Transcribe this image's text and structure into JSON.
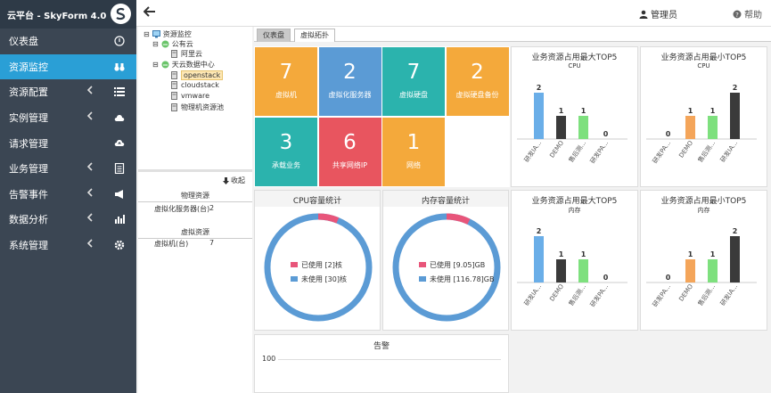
{
  "app": {
    "title": "云平台 - SkyForm 4.0"
  },
  "topbar": {
    "user": "管理员",
    "help": "帮助"
  },
  "sidebar": {
    "items": [
      {
        "label": "仪表盘",
        "icon": "dashboard-icon",
        "has_chevron": false
      },
      {
        "label": "资源监控",
        "icon": "binoculars-icon",
        "has_chevron": false,
        "active": true
      },
      {
        "label": "资源配置",
        "icon": "list-icon",
        "has_chevron": true
      },
      {
        "label": "实例管理",
        "icon": "cloud-icon",
        "has_chevron": true
      },
      {
        "label": "请求管理",
        "icon": "cloud-upload-icon",
        "has_chevron": false
      },
      {
        "label": "业务管理",
        "icon": "document-icon",
        "has_chevron": true
      },
      {
        "label": "告警事件",
        "icon": "megaphone-icon",
        "has_chevron": true
      },
      {
        "label": "数据分析",
        "icon": "bar-chart-icon",
        "has_chevron": true
      },
      {
        "label": "系统管理",
        "icon": "gear-icon",
        "has_chevron": true
      }
    ]
  },
  "tree": {
    "root": "资源监控",
    "public_cloud": "公有云",
    "aliyun": "阿里云",
    "datacenter": "天云数据中心",
    "openstack": "openstack",
    "cloudstack": "cloudstack",
    "vmware": "vmware",
    "physical_pool": "物理机资源池"
  },
  "info": {
    "collapse": "收起",
    "physical_header": "物理资源",
    "virt_server_label": "虚拟化服务器(台)",
    "virt_server_value": "2",
    "virtual_header": "虚拟资源",
    "vm_label": "虚拟机(台)",
    "vm_value": "7"
  },
  "tabs": [
    "仪表盘",
    "虚拟拓扑"
  ],
  "tiles": [
    {
      "value": "7",
      "label": "虚拟机",
      "color": "#f4a93b"
    },
    {
      "value": "2",
      "label": "虚拟化服务器",
      "color": "#5b9bd5"
    },
    {
      "value": "7",
      "label": "虚拟硬盘",
      "color": "#2bb3ad"
    },
    {
      "value": "2",
      "label": "虚拟硬盘备份",
      "color": "#f4a93b"
    },
    {
      "value": "3",
      "label": "承载业务",
      "color": "#2bb3ad"
    },
    {
      "value": "6",
      "label": "共享网络IP",
      "color": "#e8555f"
    },
    {
      "value": "1",
      "label": "网络",
      "color": "#f4a93b"
    }
  ],
  "gauges": [
    {
      "title": "CPU容量统计",
      "used_label": "已使用 [2]核",
      "free_label": "未使用 [30]核",
      "used": 2,
      "total": 32
    },
    {
      "title": "内存容量统计",
      "used_label": "已使用 [9.05]GB",
      "free_label": "未使用 [116.78]GB",
      "used": 9.05,
      "total": 125.83
    }
  ],
  "alarm": {
    "title": "告警",
    "ytick": "100"
  },
  "colors": {
    "used": "#e8557a",
    "free": "#5b9bd5"
  },
  "chart_data": [
    {
      "type": "bar",
      "title": "业务资源占用最大TOP5",
      "subtitle": "CPU",
      "categories": [
        "研发IA...",
        "DEMO",
        "售后测...",
        "研发PA..."
      ],
      "values": [
        2,
        1,
        1,
        0
      ],
      "colors": [
        "#6aaee8",
        "#3a3a3a",
        "#7ee07e",
        "#999999"
      ],
      "ylim": [
        0,
        2
      ]
    },
    {
      "type": "bar",
      "title": "业务资源占用最小TOP5",
      "subtitle": "CPU",
      "categories": [
        "研发PA...",
        "DEMO",
        "售后测...",
        "研发IA..."
      ],
      "values": [
        0,
        1,
        1,
        2
      ],
      "colors": [
        "#999999",
        "#f4a55a",
        "#7ee07e",
        "#3a3a3a"
      ],
      "ylim": [
        0,
        2
      ]
    },
    {
      "type": "bar",
      "title": "业务资源占用最大TOP5",
      "subtitle": "内存",
      "categories": [
        "研发IA...",
        "DEMO",
        "售后测...",
        "研发PA..."
      ],
      "values": [
        2,
        1,
        1,
        0
      ],
      "colors": [
        "#6aaee8",
        "#3a3a3a",
        "#7ee07e",
        "#999999"
      ],
      "ylim": [
        0,
        2
      ]
    },
    {
      "type": "bar",
      "title": "业务资源占用最小TOP5",
      "subtitle": "内存",
      "categories": [
        "研发PA...",
        "DEMO",
        "售后测...",
        "研发IA..."
      ],
      "values": [
        0,
        1,
        1,
        2
      ],
      "colors": [
        "#999999",
        "#f4a55a",
        "#7ee07e",
        "#3a3a3a"
      ],
      "ylim": [
        0,
        2
      ]
    }
  ]
}
